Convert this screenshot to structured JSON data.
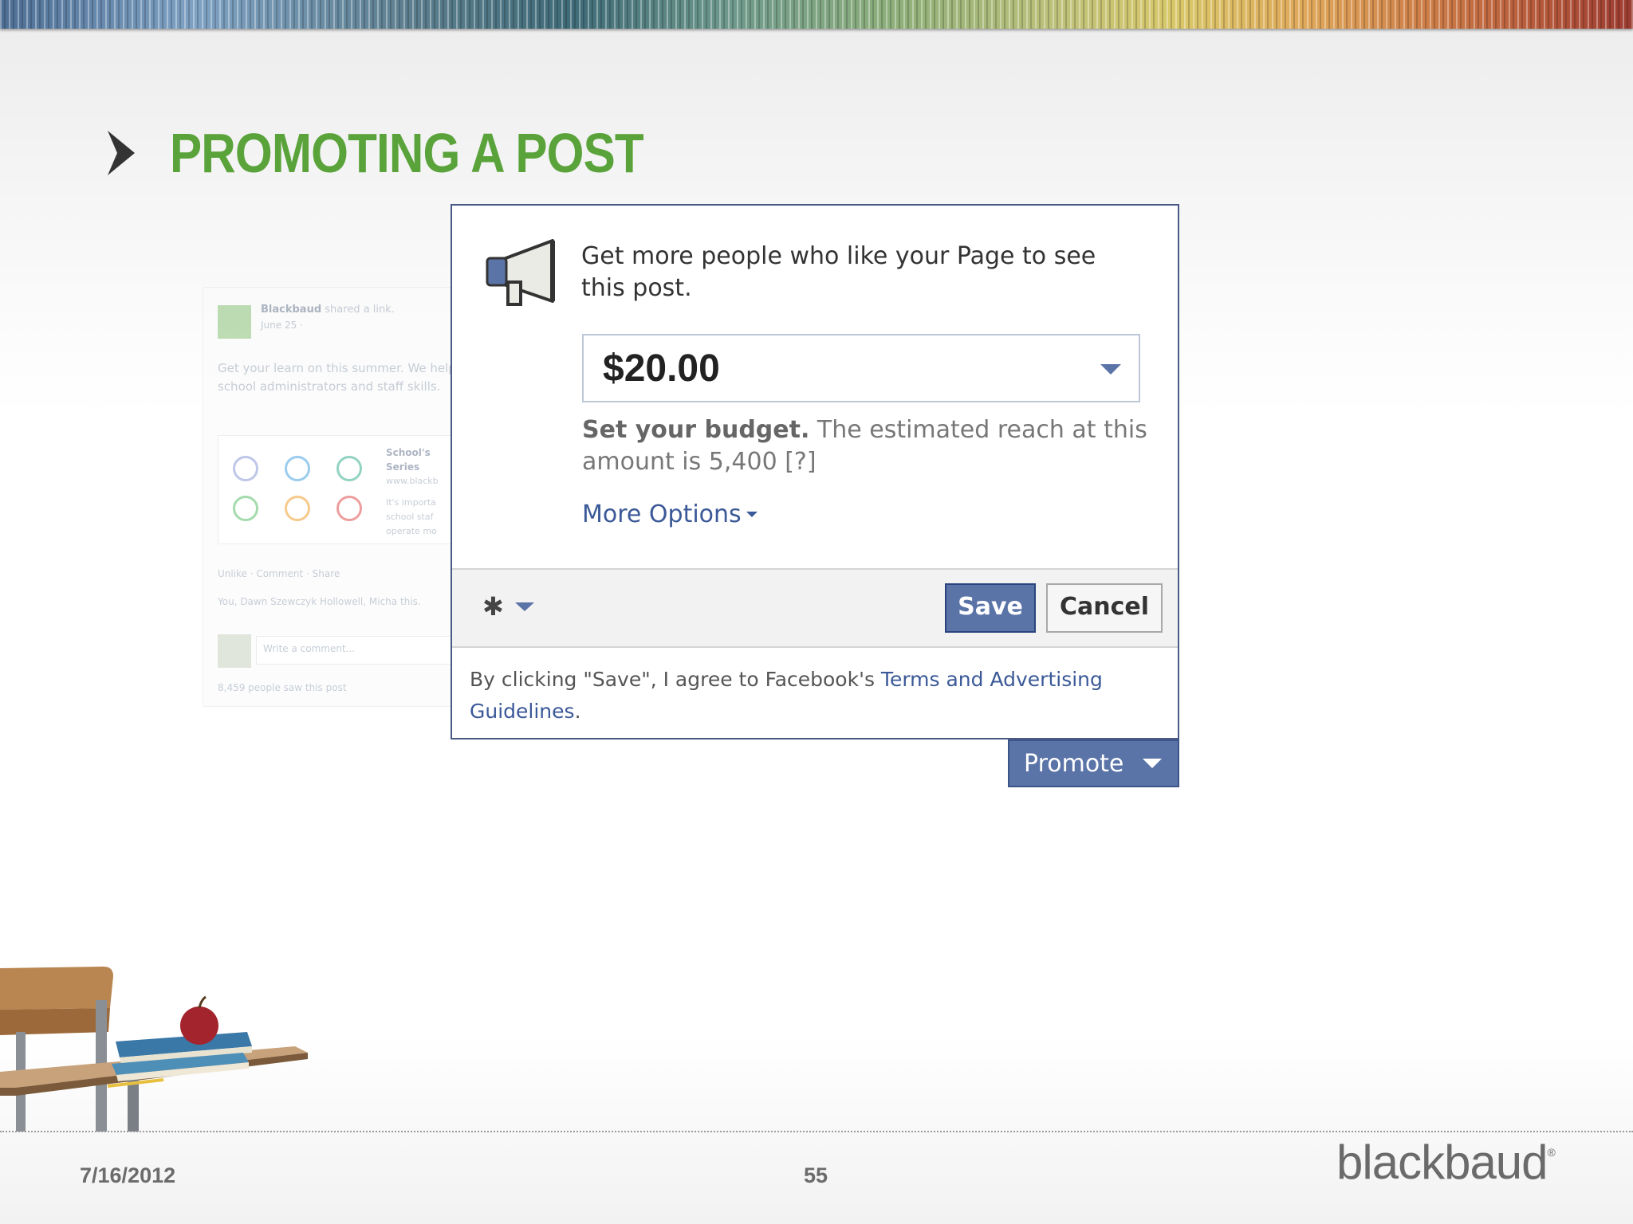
{
  "slide": {
    "title": "PROMOTING A POST",
    "date": "7/16/2012",
    "page_number": "55",
    "logo": "blackbaud",
    "logo_mark": "®"
  },
  "background_post": {
    "author": "Blackbaud",
    "action": "shared a link.",
    "meta": "June 25 ·",
    "message": "Get your learn on this summer. We help school administrators and staff skills.",
    "card_title": "School's Series",
    "card_url": "www.blackb",
    "card_desc": "It's importa school staf operate mo",
    "actions": "Unlike · Comment · Share",
    "likes": "You, Dawn Szewczyk Hollowell, Micha this.",
    "comment_placeholder": "Write a comment...",
    "seen": "8,459 people saw this post"
  },
  "dialog": {
    "prompt": "Get more people who like your Page to see this post.",
    "budget_value": "$20.00",
    "help_bold": "Set your budget.",
    "help_text": " The estimated reach at this amount is 5,400 ",
    "help_link": "[?]",
    "more_options": "More Options",
    "save_label": "Save",
    "cancel_label": "Cancel",
    "terms_prefix": "By clicking \"Save\", I agree to Facebook's ",
    "terms_link": "Terms and Advertising Guidelines",
    "terms_suffix": ".",
    "promote_label": "Promote"
  },
  "icons": {
    "title_bullet": "chevron-right-icon",
    "megaphone": "megaphone-icon",
    "gear": "gear-icon"
  },
  "colors": {
    "title_green": "#5aa33b",
    "facebook_blue": "#3b5998",
    "button_blue": "#5b74a8"
  }
}
